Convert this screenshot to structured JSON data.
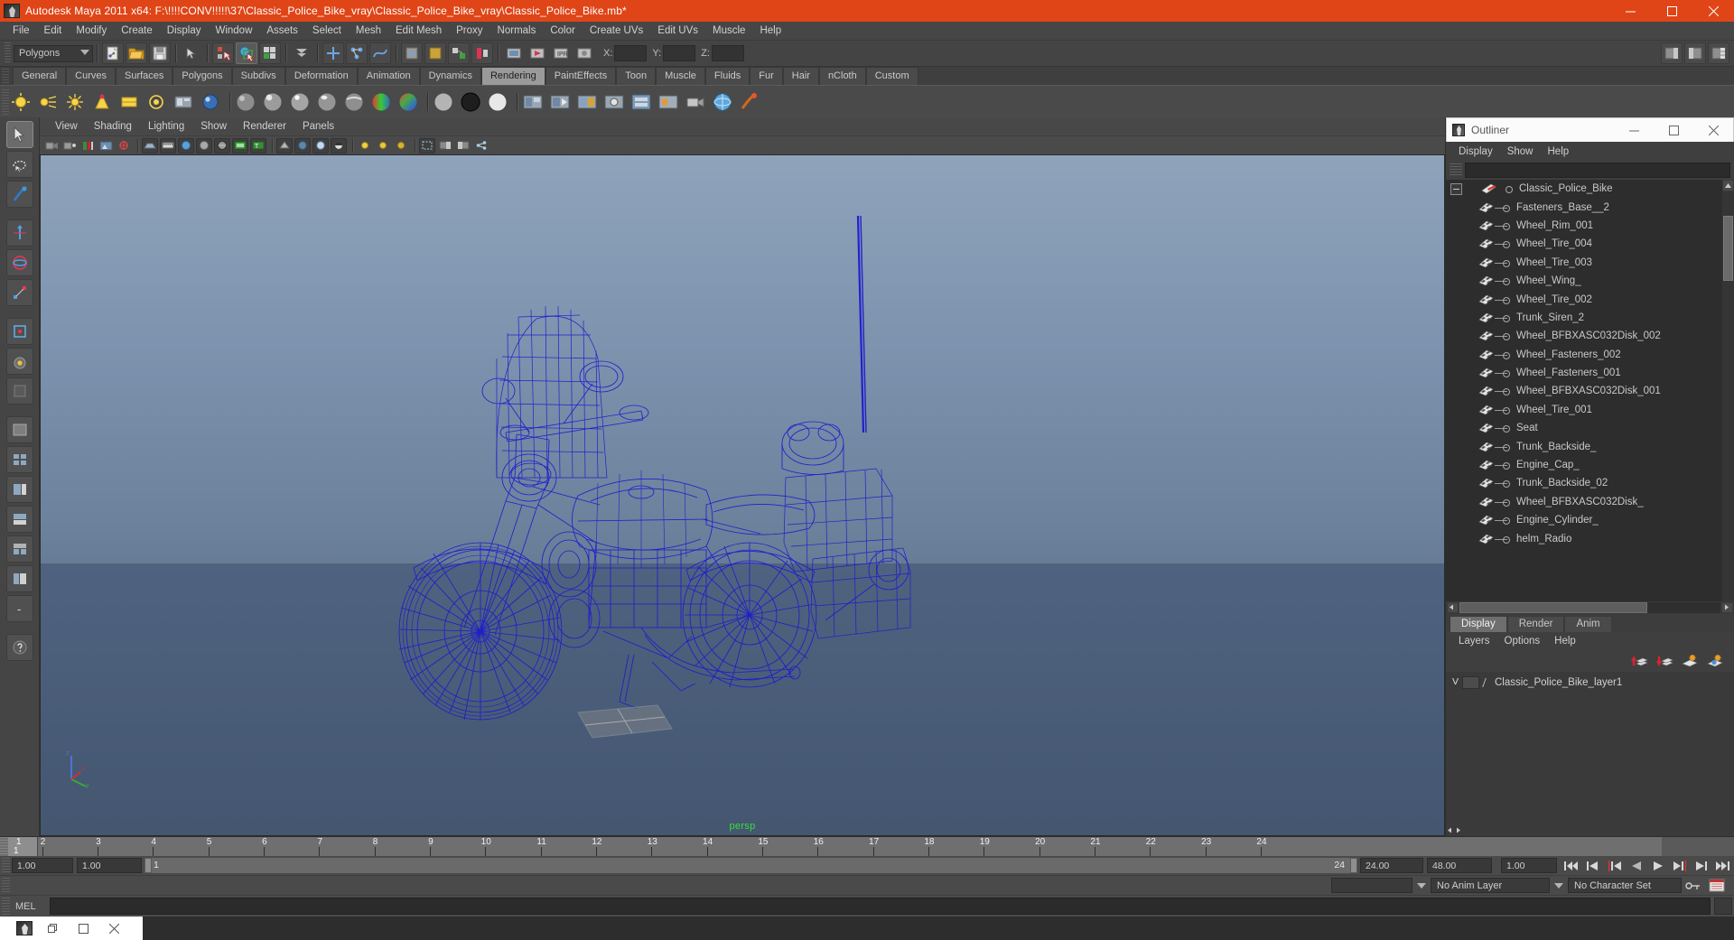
{
  "titlebar": {
    "title": "Autodesk Maya 2011 x64: F:\\!!!!CONV!!!!!\\37\\Classic_Police_Bike_vray\\Classic_Police_Bike_vray\\Classic_Police_Bike.mb*",
    "app_icon": "maya-icon",
    "minimize": "minimize-icon",
    "maximize": "maximize-icon",
    "close": "close-icon"
  },
  "menubar": {
    "items": [
      {
        "label": "File"
      },
      {
        "label": "Edit"
      },
      {
        "label": "Modify"
      },
      {
        "label": "Create"
      },
      {
        "label": "Display"
      },
      {
        "label": "Window"
      },
      {
        "label": "Assets"
      },
      {
        "label": "Select"
      },
      {
        "label": "Mesh"
      },
      {
        "label": "Edit Mesh"
      },
      {
        "label": "Proxy"
      },
      {
        "label": "Normals"
      },
      {
        "label": "Color"
      },
      {
        "label": "Create UVs"
      },
      {
        "label": "Edit UVs"
      },
      {
        "label": "Muscle"
      },
      {
        "label": "Help"
      }
    ]
  },
  "statusbar": {
    "menuset": "Polygons",
    "x_label": "X:",
    "y_label": "Y:",
    "z_label": "Z:",
    "x_value": "",
    "y_value": "",
    "z_value": ""
  },
  "shelf": {
    "tabs": [
      {
        "label": "General",
        "active": false
      },
      {
        "label": "Curves",
        "active": false
      },
      {
        "label": "Surfaces",
        "active": false
      },
      {
        "label": "Polygons",
        "active": false
      },
      {
        "label": "Subdivs",
        "active": false
      },
      {
        "label": "Deformation",
        "active": false
      },
      {
        "label": "Animation",
        "active": false
      },
      {
        "label": "Dynamics",
        "active": false
      },
      {
        "label": "Rendering",
        "active": true
      },
      {
        "label": "PaintEffects",
        "active": false
      },
      {
        "label": "Toon",
        "active": false
      },
      {
        "label": "Muscle",
        "active": false
      },
      {
        "label": "Fluids",
        "active": false
      },
      {
        "label": "Fur",
        "active": false
      },
      {
        "label": "Hair",
        "active": false
      },
      {
        "label": "nCloth",
        "active": false
      },
      {
        "label": "Custom",
        "active": false
      }
    ]
  },
  "viewport": {
    "menus": [
      {
        "label": "View"
      },
      {
        "label": "Shading"
      },
      {
        "label": "Lighting"
      },
      {
        "label": "Show"
      },
      {
        "label": "Renderer"
      },
      {
        "label": "Panels"
      }
    ],
    "camera_label": "persp",
    "wireframe_color": "#1c1ccd",
    "sky_top": "#8fa3bb",
    "sky_bottom": "#536780",
    "axis": {
      "x": "x",
      "y": "y",
      "z": "z"
    }
  },
  "outliner": {
    "window_title": "Outliner",
    "menus": [
      {
        "label": "Display"
      },
      {
        "label": "Show"
      },
      {
        "label": "Help"
      }
    ],
    "search_value": "",
    "root": {
      "label": "Classic_Police_Bike",
      "icon": "transform-icon",
      "expanded": true
    },
    "items": [
      {
        "label": "Fasteners_Base__2",
        "icon": "mesh-icon"
      },
      {
        "label": "Wheel_Rim_001",
        "icon": "mesh-icon"
      },
      {
        "label": "Wheel_Tire_004",
        "icon": "mesh-icon"
      },
      {
        "label": "Wheel_Tire_003",
        "icon": "mesh-icon"
      },
      {
        "label": "Wheel_Wing_",
        "icon": "mesh-icon"
      },
      {
        "label": "Wheel_Tire_002",
        "icon": "mesh-icon"
      },
      {
        "label": "Trunk_Siren_2",
        "icon": "mesh-icon"
      },
      {
        "label": "Wheel_BFBXASC032Disk_002",
        "icon": "mesh-icon"
      },
      {
        "label": "Wheel_Fasteners_002",
        "icon": "mesh-icon"
      },
      {
        "label": "Wheel_Fasteners_001",
        "icon": "mesh-icon"
      },
      {
        "label": "Wheel_BFBXASC032Disk_001",
        "icon": "mesh-icon"
      },
      {
        "label": "Wheel_Tire_001",
        "icon": "mesh-icon"
      },
      {
        "label": "Seat",
        "icon": "mesh-icon"
      },
      {
        "label": "Trunk_Backside_",
        "icon": "mesh-icon"
      },
      {
        "label": "Engine_Cap_",
        "icon": "mesh-icon"
      },
      {
        "label": "Trunk_Backside_02",
        "icon": "mesh-icon"
      },
      {
        "label": "Wheel_BFBXASC032Disk_",
        "icon": "mesh-icon"
      },
      {
        "label": "Engine_Cylinder_",
        "icon": "mesh-icon"
      },
      {
        "label": "helm_Radio",
        "icon": "mesh-icon"
      }
    ]
  },
  "layers": {
    "tabs": [
      {
        "label": "Display",
        "active": true
      },
      {
        "label": "Render",
        "active": false
      },
      {
        "label": "Anim",
        "active": false
      }
    ],
    "menus": [
      {
        "label": "Layers"
      },
      {
        "label": "Options"
      },
      {
        "label": "Help"
      }
    ],
    "buttons": [
      {
        "name": "move-layer-up-icon"
      },
      {
        "name": "move-layer-down-icon"
      },
      {
        "name": "new-layer-icon"
      },
      {
        "name": "new-layer-from-selected-icon"
      }
    ],
    "items": [
      {
        "visibility": "V",
        "playback": "",
        "name": "Classic_Police_Bike_layer1"
      }
    ]
  },
  "timeline": {
    "ticks": [
      "1",
      "2",
      "3",
      "4",
      "5",
      "6",
      "7",
      "8",
      "9",
      "10",
      "11",
      "12",
      "13",
      "14",
      "15",
      "16",
      "17",
      "18",
      "19",
      "20",
      "21",
      "22",
      "23",
      "24"
    ],
    "current_frame": "1",
    "range_start_field": "1.00",
    "range_end_field": "1.00",
    "range_bar_start": "1",
    "range_bar_end": "24",
    "anim_start": "24.00",
    "anim_end": "48.00",
    "playback_speed": "1.00",
    "playback_buttons": [
      {
        "name": "go-to-start-button"
      },
      {
        "name": "step-back-keyframe-button"
      },
      {
        "name": "step-back-frame-button"
      },
      {
        "name": "play-backwards-button"
      },
      {
        "name": "play-forwards-button"
      },
      {
        "name": "step-forward-frame-button"
      },
      {
        "name": "step-forward-keyframe-button"
      },
      {
        "name": "go-to-end-button"
      }
    ],
    "anim_layer": "No Anim Layer",
    "character_set": "No Character Set"
  },
  "command_line": {
    "label": "MEL",
    "value": "",
    "placeholder": ""
  },
  "taskbar": {
    "app_icon": "maya-icon",
    "restore": "restore-icon",
    "maximize": "maximize-icon",
    "close": "close-icon"
  }
}
